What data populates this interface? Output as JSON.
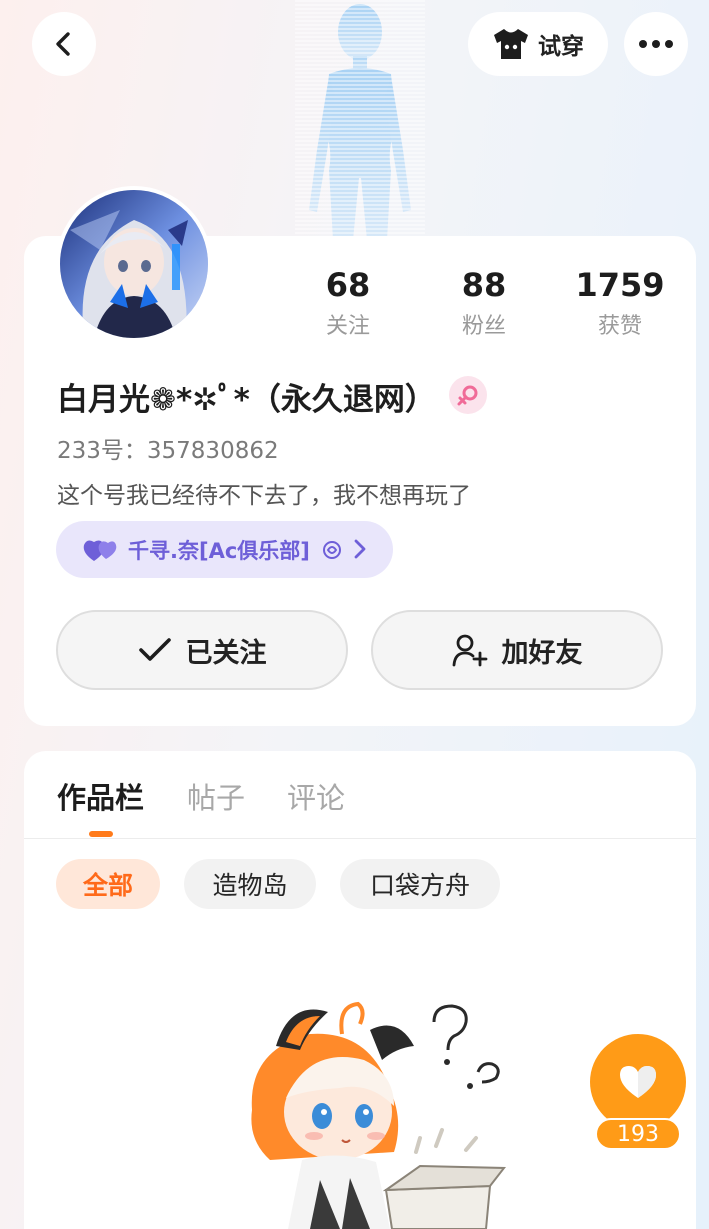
{
  "header": {
    "try_on_label": "试穿",
    "back_icon": "chevron-left-icon",
    "more_icon": "more-dots-icon",
    "try_on_icon": "tshirt-icon"
  },
  "profile": {
    "stats": [
      {
        "value": "68",
        "label": "关注"
      },
      {
        "value": "88",
        "label": "粉丝"
      },
      {
        "value": "1759",
        "label": "获赞"
      }
    ],
    "nickname": "白月光❁*✲ﾟ*（永久退网）",
    "gender_icon": "female-icon",
    "uid": "233号：357830862",
    "bio": "这个号我已经待不下去了，我不想再玩了",
    "club_name": "千寻.奈[Ac俱乐部]",
    "follow_label": "已关注",
    "add_friend_label": "加好友"
  },
  "works": {
    "tabs": [
      {
        "label": "作品栏",
        "active": true
      },
      {
        "label": "帖子",
        "active": false
      },
      {
        "label": "评论",
        "active": false
      }
    ],
    "chips": [
      {
        "label": "全部",
        "active": true
      },
      {
        "label": "造物岛",
        "active": false
      },
      {
        "label": "口袋方舟",
        "active": false
      }
    ]
  },
  "like": {
    "count": "193"
  },
  "colors": {
    "accent_orange": "#ff7a1a",
    "like_orange": "#ff9b17",
    "club_purple": "#6e5fd8",
    "gender_pink": "#f06b98"
  }
}
